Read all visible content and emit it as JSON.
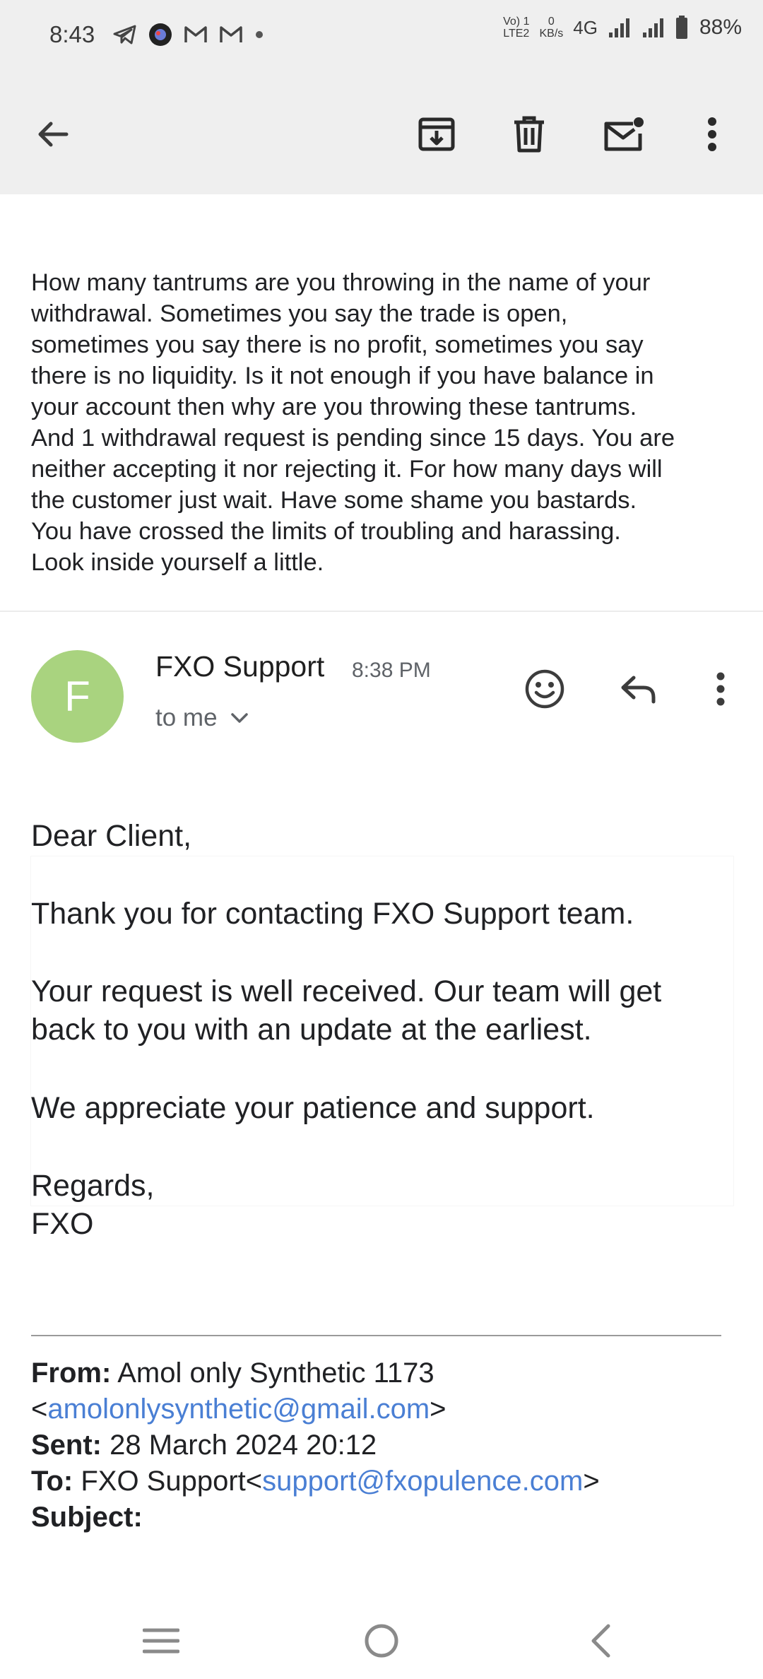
{
  "status_bar": {
    "time": "8:43",
    "net_top": "Vo) 1",
    "net_bottom": "LTE2",
    "speed_top": "0",
    "speed_bottom": "KB/s",
    "network": "4G",
    "battery": "88%"
  },
  "icons": {
    "back": "back-arrow-icon",
    "archive": "archive-icon",
    "delete": "trash-icon",
    "mark_unread": "mail-unread-icon",
    "more": "more-vert-icon",
    "emoji": "emoji-smile-icon",
    "reply": "reply-icon",
    "expand": "chevron-down-icon"
  },
  "previous_message": {
    "lines": [
      "How many tantrums are you throwing in the name of your",
      "withdrawal. Sometimes you say the trade is open,",
      "sometimes you say there is no profit, sometimes you say",
      "there is no liquidity. Is it not enough if you have balance in",
      "your account then why are you throwing these tantrums.",
      "And 1 withdrawal request is pending since 15 days. You are",
      "neither accepting it nor rejecting it. For how many days will",
      "the customer just wait. Have some shame you bastards.",
      "You have crossed the limits of troubling and harassing.",
      "Look inside yourself a little."
    ]
  },
  "message": {
    "avatar_letter": "F",
    "sender": "FXO Support",
    "time": "8:38 PM",
    "recipient": "to me",
    "greeting": "Dear Client,",
    "para1": "Thank you for contacting FXO Support team.",
    "para2_line1": "Your request is well received. Our team will get",
    "para2_line2": "back to you with an update at the earliest.",
    "para3": "We appreciate your patience and support.",
    "closing": "Regards,",
    "signature": "FXO"
  },
  "quoted": {
    "from_label": "From:",
    "from_name": "Amol only Synthetic 1173",
    "from_email": "amolonlysynthetic@gmail.com",
    "sent_label": "Sent:",
    "sent_value": "28 March 2024 20:12",
    "to_label": "To:",
    "to_name": "FXO Support",
    "to_email": "support@fxopulence.com",
    "subject_label": "Subject:"
  },
  "colors": {
    "avatar": "#a9d37f",
    "link": "#4a7fd4",
    "app_bar": "#efefef"
  }
}
